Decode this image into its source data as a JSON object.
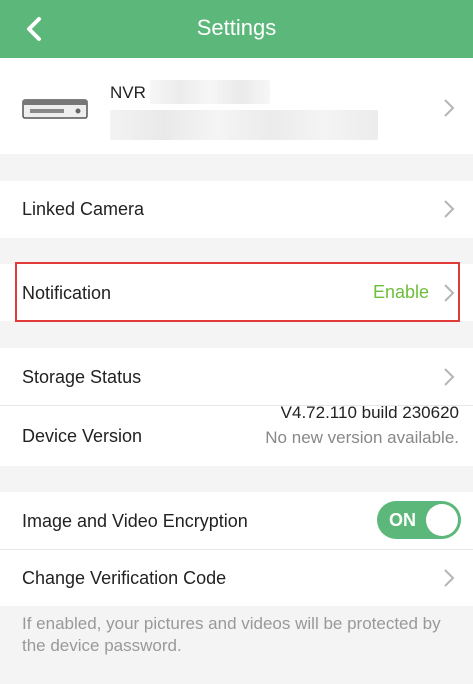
{
  "header": {
    "title": "Settings",
    "back_icon": "chevron-left-icon"
  },
  "device": {
    "name": "NVR",
    "icon": "nvr-device-icon"
  },
  "rows": {
    "linked_camera": "Linked Camera",
    "notification": "Notification",
    "notification_status": "Enable",
    "storage_status": "Storage Status",
    "device_version": "Device Version",
    "version_value": "V4.72.110 build 230620",
    "version_note": "No new version available.",
    "encryption": "Image and Video Encryption",
    "encryption_toggle": "ON",
    "change_code": "Change Verification Code"
  },
  "footer_note": "If enabled, your pictures and videos will be protected by the device password.",
  "colors": {
    "accent": "#5cb77a",
    "enable": "#6cbf3a",
    "highlight": "#e03a3a"
  }
}
